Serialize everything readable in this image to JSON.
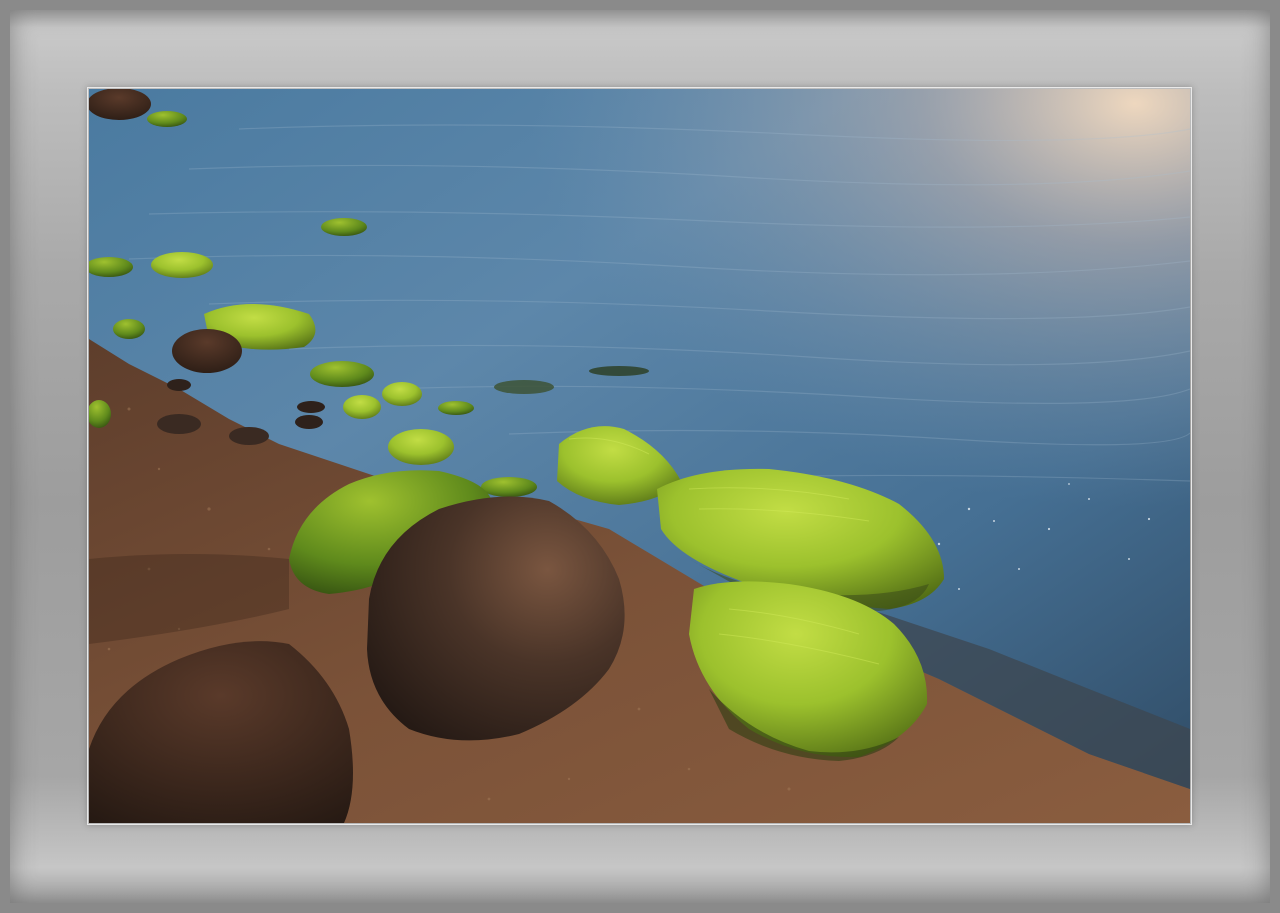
{
  "scene": {
    "subject": "moss-covered-rocks-on-shoreline",
    "colors": {
      "water_deep": "#3f6f95",
      "water_light": "#8fa9bf",
      "sky_glow": "#f3dcc0",
      "sand": "#7a4f36",
      "moss": "#8fb82a",
      "moss_bright": "#b6d83a",
      "rock_dark": "#3a2a22",
      "frame": "#a8a8a8"
    }
  }
}
